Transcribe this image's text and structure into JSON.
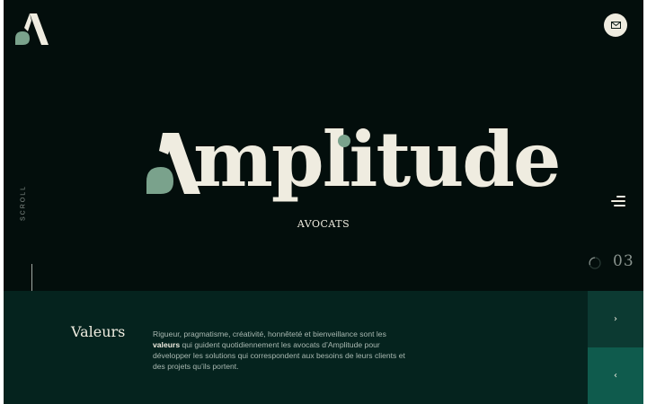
{
  "brand": {
    "name": "Amplitude",
    "name_body": "mplitude",
    "subtitle": "AVOCATS"
  },
  "header": {
    "logo_icon": "amplitude-logo-icon",
    "contact_icon": "mail-icon"
  },
  "side": {
    "scroll_label": "SCROLL"
  },
  "menu": {
    "icon": "hamburger-icon"
  },
  "slider": {
    "current": "03",
    "spinner_icon": "loading-ring-icon"
  },
  "panel": {
    "title": "Valeurs",
    "text_before": "Rigueur, pragmatisme, créativité, honnêteté et bienveillance sont les ",
    "text_bold": "valeurs",
    "text_after": " qui guident quotidiennement les avocats d’Amplitude pour développer les solutions qui correspondent aux besoins de leurs clients et des projets qu’ils portent.",
    "next_label": "›",
    "prev_label": "‹"
  },
  "colors": {
    "background": "#030e0c",
    "panel": "#05231e",
    "cream": "#efece0",
    "sage": "#7aa28c",
    "nav_top": "#0c3a32",
    "nav_bottom": "#0f5b4d"
  }
}
